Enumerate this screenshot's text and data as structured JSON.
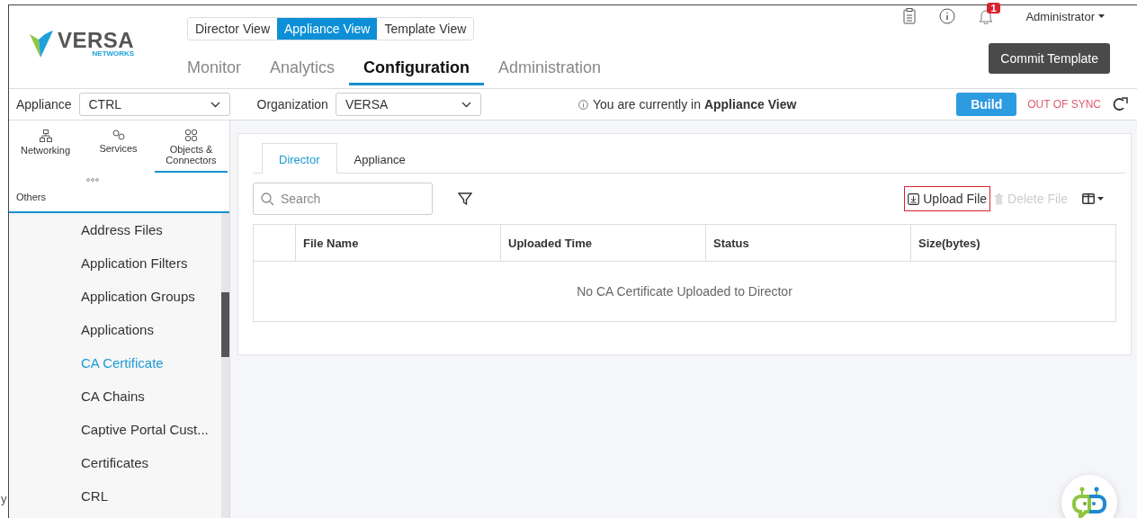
{
  "logo": {
    "brand": "VERSA",
    "sub": "NETWORKS"
  },
  "view_switch": [
    {
      "label": "Director View",
      "selected": false
    },
    {
      "label": "Appliance View",
      "selected": true
    },
    {
      "label": "Template View",
      "selected": false
    }
  ],
  "nav_tabs": [
    {
      "label": "Monitor",
      "selected": false
    },
    {
      "label": "Analytics",
      "selected": false
    },
    {
      "label": "Configuration",
      "selected": true
    },
    {
      "label": "Administration",
      "selected": false
    }
  ],
  "notification_badge": "1",
  "user": "Administrator",
  "commit_button": "Commit Template",
  "toolbar": {
    "appliance": {
      "label": "Appliance",
      "value": "CTRL"
    },
    "organization": {
      "label": "Organization",
      "value": "VERSA"
    },
    "info": "You are currently in **Appliance View**",
    "build_button": "Build",
    "sync_status": "OUT OF SYNC"
  },
  "sidebar": {
    "categories": [
      {
        "label": "Networking",
        "kind": "networking",
        "selected": false
      },
      {
        "label": "Services",
        "kind": "services",
        "selected": false
      },
      {
        "label": "Objects & Connectors",
        "kind": "objects",
        "selected": true
      },
      {
        "label": "Others",
        "kind": "others",
        "selected": false
      }
    ],
    "items": [
      {
        "label": "Address Files",
        "selected": false
      },
      {
        "label": "Application Filters",
        "selected": false
      },
      {
        "label": "Application Groups",
        "selected": false
      },
      {
        "label": "Applications",
        "selected": false
      },
      {
        "label": "CA Certificate",
        "selected": true
      },
      {
        "label": "CA Chains",
        "selected": false
      },
      {
        "label": "Captive Portal Cust...",
        "selected": false
      },
      {
        "label": "Certificates",
        "selected": false
      },
      {
        "label": "CRL",
        "selected": false
      }
    ]
  },
  "content": {
    "tabs": [
      {
        "label": "Director",
        "selected": true
      },
      {
        "label": "Appliance",
        "selected": false
      }
    ],
    "search": {
      "placeholder": "Search"
    },
    "actions": [
      {
        "label": "Upload File",
        "kind": "upload",
        "disabled": false,
        "highlighted": true
      },
      {
        "label": "Delete File",
        "kind": "delete",
        "disabled": true,
        "highlighted": false
      }
    ],
    "table": {
      "columns": [
        "File Name",
        "Uploaded Time",
        "Status",
        "Size(bytes)"
      ],
      "empty_message": "No CA Certificate Uploaded to Director"
    }
  },
  "background_fragment": "y"
}
